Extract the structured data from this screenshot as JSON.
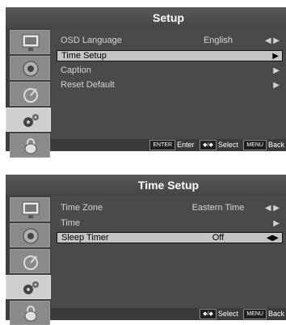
{
  "setup_panel": {
    "title": "Setup",
    "items": [
      {
        "label": "OSD Language",
        "value": "English",
        "arrow": "◀ ▶"
      },
      {
        "label": "Time Setup",
        "value": "",
        "arrow": "▶"
      },
      {
        "label": "Caption",
        "value": "",
        "arrow": "▶"
      },
      {
        "label": "Reset Default",
        "value": "",
        "arrow": "▶"
      }
    ],
    "footer": {
      "enter_key": "ENTER",
      "enter_label": "Enter",
      "select_key": "◆/◆",
      "select_label": "Select",
      "menu_key": "MENU",
      "menu_label": "Back"
    }
  },
  "time_setup_panel": {
    "title": "Time Setup",
    "items": [
      {
        "label": "Time Zone",
        "value": "Eastern Time",
        "arrow": "◀ ▶"
      },
      {
        "label": "Time",
        "value": "",
        "arrow": "▶"
      },
      {
        "label": "Sleep Timer",
        "value": "Off",
        "arrow": "◀▶"
      }
    ],
    "footer": {
      "select_key": "◆/◆",
      "select_label": "Select",
      "menu_key": "MENU",
      "menu_label": "Back"
    }
  },
  "side_icons": [
    "picture-icon",
    "sound-icon",
    "channel-icon",
    "setup-icon",
    "lock-icon"
  ],
  "colors": {
    "panel_bg": "#4a4a4a",
    "highlight_bg": "#c4c4c4",
    "active_tile": "#cfcfcf"
  }
}
